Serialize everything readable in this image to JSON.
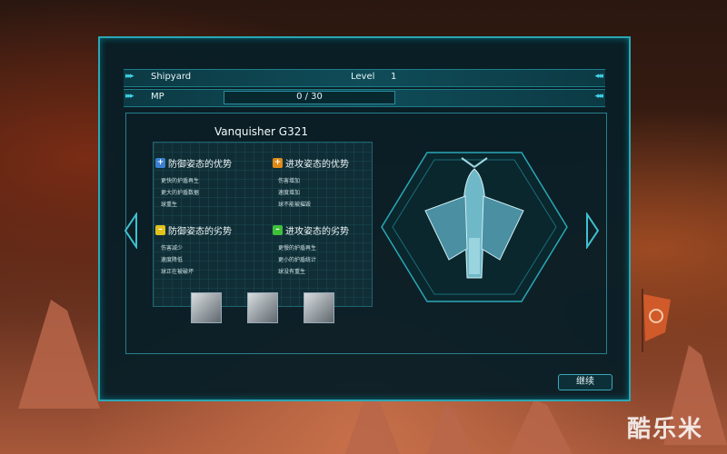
{
  "header": {
    "screen_label": "Shipyard",
    "level_label": "Level",
    "level_value": "1",
    "mp_label": "MP",
    "mp_value": "0 / 30",
    "mp_fraction": 0
  },
  "ship": {
    "name": "Vanquisher G321"
  },
  "sections": [
    {
      "title": "防御姿态的优势",
      "icon": "shield-plus-icon",
      "color": "#3a7fd0",
      "items": [
        "更快的护盾再生",
        "更大的护盾数据",
        "球重生"
      ]
    },
    {
      "title": "进攻姿态的优势",
      "icon": "attack-plus-icon",
      "color": "#e08a16",
      "items": [
        "伤害增加",
        "速度增加",
        "球不能被摧毁"
      ]
    },
    {
      "title": "防御姿态的劣势",
      "icon": "shield-minus-icon",
      "color": "#e0c21a",
      "items": [
        "伤害减少",
        "速度降低",
        "球正在被破坏"
      ]
    },
    {
      "title": "进攻姿态的劣势",
      "icon": "attack-minus-icon",
      "color": "#3fbf3a",
      "items": [
        "更慢的护盾再生",
        "更小的护盾统计",
        "球没有重生"
      ]
    }
  ],
  "skills": [
    "explosion-skill-icon",
    "meditation-skill-icon",
    "shield-skill-icon"
  ],
  "buttons": {
    "continue": "继续"
  },
  "watermark": "酷乐米",
  "colors": {
    "accent": "#2aa7b6",
    "panel": "#081e26"
  }
}
